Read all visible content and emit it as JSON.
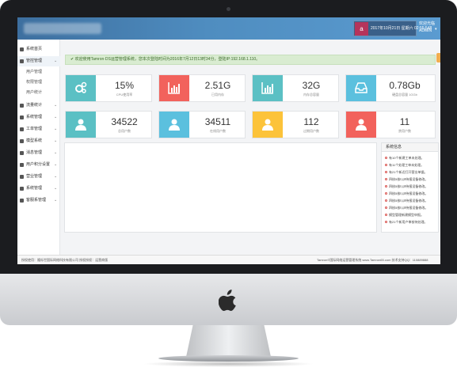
{
  "header": {
    "user_badge": "a",
    "datetime": "2017年10月21日 星期六 02:55:548",
    "welcome": "欢迎光临",
    "username": "ADMIN"
  },
  "sidebar": {
    "items": [
      {
        "label": "系统首页"
      },
      {
        "label": "管控管理"
      },
      {
        "label": "用户管理",
        "sub": true
      },
      {
        "label": "权限管理",
        "sub": true
      },
      {
        "label": "用户统计",
        "sub": true
      },
      {
        "label": "流量统计"
      },
      {
        "label": "系统管理"
      },
      {
        "label": "工单管理"
      },
      {
        "label": "模型系统"
      },
      {
        "label": "消息管理"
      },
      {
        "label": "用户积分设置"
      },
      {
        "label": "营业管理"
      },
      {
        "label": "系统管理"
      },
      {
        "label": "客服系管理"
      }
    ]
  },
  "notice": "✔ 欢迎使用Tamron·DS运营管理系统，您本次登陆时间为2016年7月12日13时34分，登陆IP:192.168.1.110。",
  "stats": [
    {
      "value": "15%",
      "caption": "CPU使用率",
      "color": "#5bc0c4",
      "icon": "gears-icon"
    },
    {
      "value": "2.51G",
      "caption": "已用内存",
      "color": "#f2625c",
      "icon": "bar-chart-icon"
    },
    {
      "value": "32G",
      "caption": "内存总容量",
      "color": "#5bc0c4",
      "icon": "bar-chart-icon"
    },
    {
      "value": "0.78Gb",
      "caption": "硬盘总容量 1GGb",
      "color": "#5bc0de",
      "icon": "inbox-icon"
    },
    {
      "value": "34522",
      "caption": "总用户数",
      "color": "#5bc0c4",
      "icon": "user-icon"
    },
    {
      "value": "34511",
      "caption": "在线用户数",
      "color": "#5bc0de",
      "icon": "user-icon"
    },
    {
      "value": "112",
      "caption": "过期用户数",
      "color": "#fcc33a",
      "icon": "user-icon"
    },
    {
      "value": "11",
      "caption": "禁用户数",
      "color": "#f2625c",
      "icon": "user-icon"
    }
  ],
  "system_panel": {
    "title": "系统信息",
    "items": [
      "有10个新建工单未处理。",
      "有11个处理工单未处理。",
      "有21个新近打开营业单据。",
      "四核5核Ⅰ公Ⅱ待报设备修改。",
      "四核5核Ⅰ公Ⅱ待报设备修改。",
      "四核5核Ⅰ公Ⅱ待报设备修改。",
      "四核5核Ⅰ公Ⅱ待报设备修改。",
      "四核5核Ⅰ公Ⅱ待报设备修改。",
      "模型管理新建模型申报。",
      "有21个新用户审核待处理。"
    ]
  },
  "footer": {
    "left": "授权使用：隆烁世国际网络科技有限公司 授权授权：运营商版",
    "right": "Tamron©国际网络运营管理系统 www.Tamron65.com 技术支持QQ：110889888"
  }
}
